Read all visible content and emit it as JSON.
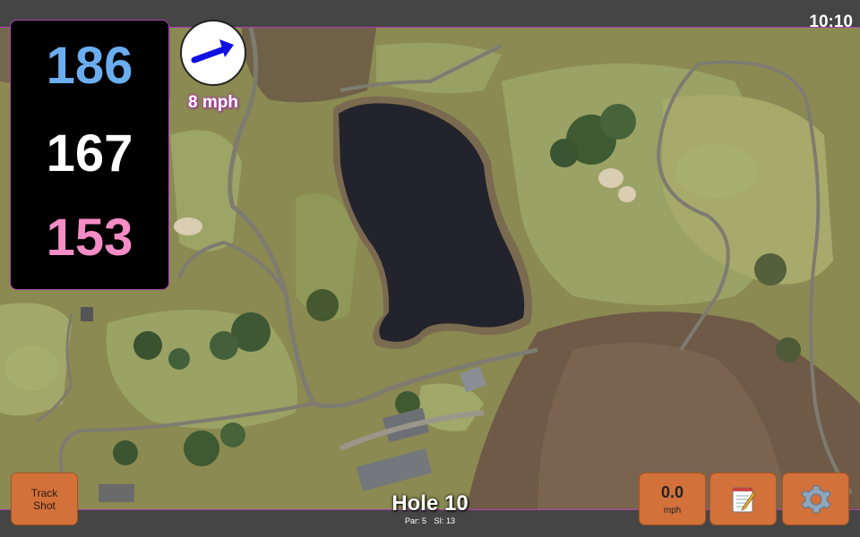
{
  "status": {
    "time": "10:10"
  },
  "distances": {
    "back": "186",
    "middle": "167",
    "front": "153",
    "colors": {
      "back": "#6aaef0",
      "middle": "#ffffff",
      "front": "#f58cc6"
    }
  },
  "wind": {
    "speed": "8 mph",
    "direction_icon": "wind-arrow-icon"
  },
  "hole": {
    "title": "Hole 10",
    "par": "Par: 5",
    "si": "SI: 13"
  },
  "buttons": {
    "track_shot_line1": "Track",
    "track_shot_line2": "Shot",
    "speed_value": "0.0",
    "speed_unit": "mph",
    "notes_icon": "notepad-icon",
    "settings_icon": "gear-icon"
  },
  "colors": {
    "button": "#d2713a",
    "panel": "#000000",
    "accent": "#b040b0"
  }
}
